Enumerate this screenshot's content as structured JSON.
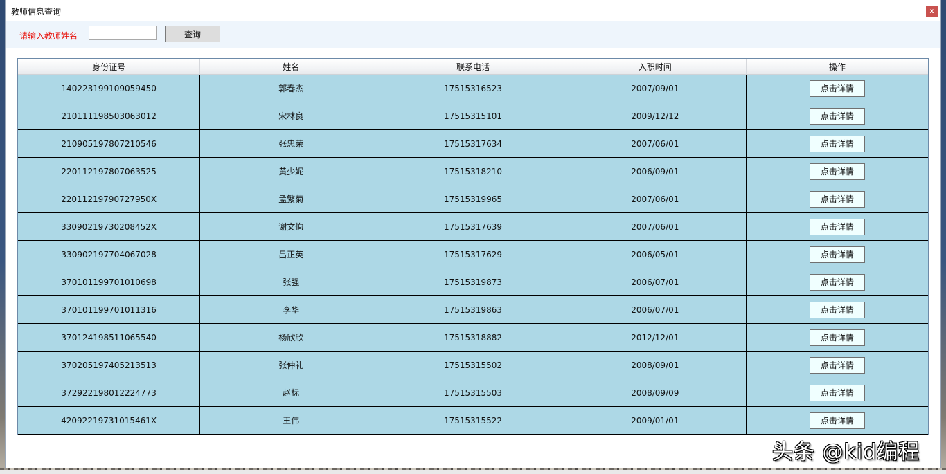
{
  "window": {
    "title": "教师信息查询",
    "close_label": "x"
  },
  "search": {
    "label": "请输入教师姓名",
    "value": "",
    "placeholder": "",
    "button_label": "查询"
  },
  "table": {
    "columns": [
      "身份证号",
      "姓名",
      "联系电话",
      "入职时间",
      "操作"
    ],
    "rows": [
      {
        "id": "140223199109059450",
        "name": "郭春杰",
        "phone": "17515316523",
        "hire_date": "2007/09/01",
        "action": "点击详情"
      },
      {
        "id": "210111198503063012",
        "name": "宋林良",
        "phone": "17515315101",
        "hire_date": "2009/12/12",
        "action": "点击详情"
      },
      {
        "id": "210905197807210546",
        "name": "张忠荣",
        "phone": "17515317634",
        "hire_date": "2007/06/01",
        "action": "点击详情"
      },
      {
        "id": "220112197807063525",
        "name": "黄少妮",
        "phone": "17515318210",
        "hire_date": "2006/09/01",
        "action": "点击详情"
      },
      {
        "id": "22011219790727950X",
        "name": "孟繁菊",
        "phone": "17515319965",
        "hire_date": "2007/06/01",
        "action": "点击详情"
      },
      {
        "id": "33090219730208452X",
        "name": "谢文恂",
        "phone": "17515317639",
        "hire_date": "2007/06/01",
        "action": "点击详情"
      },
      {
        "id": "330902197704067028",
        "name": "吕正英",
        "phone": "17515317629",
        "hire_date": "2006/05/01",
        "action": "点击详情"
      },
      {
        "id": "370101199701010698",
        "name": "张强",
        "phone": "17515319873",
        "hire_date": "2006/07/01",
        "action": "点击详情"
      },
      {
        "id": "370101199701011316",
        "name": "李华",
        "phone": "17515319863",
        "hire_date": "2006/07/01",
        "action": "点击详情"
      },
      {
        "id": "370124198511065540",
        "name": "杨欣欣",
        "phone": "17515318882",
        "hire_date": "2012/12/01",
        "action": "点击详情"
      },
      {
        "id": "370205197405213513",
        "name": "张仲礼",
        "phone": "17515315502",
        "hire_date": "2008/09/01",
        "action": "点击详情"
      },
      {
        "id": "372922198012224773",
        "name": "赵标",
        "phone": "17515315503",
        "hire_date": "2008/09/09",
        "action": "点击详情"
      },
      {
        "id": "42092219731015461X",
        "name": "王伟",
        "phone": "17515315522",
        "hire_date": "2009/01/01",
        "action": "点击详情"
      }
    ]
  },
  "watermark": "头条 @kid编程",
  "colors": {
    "row_background": "#add8e6",
    "label_red": "#e8120c",
    "close_button": "#c9524f",
    "detail_button_bg": "#f0ffff"
  }
}
